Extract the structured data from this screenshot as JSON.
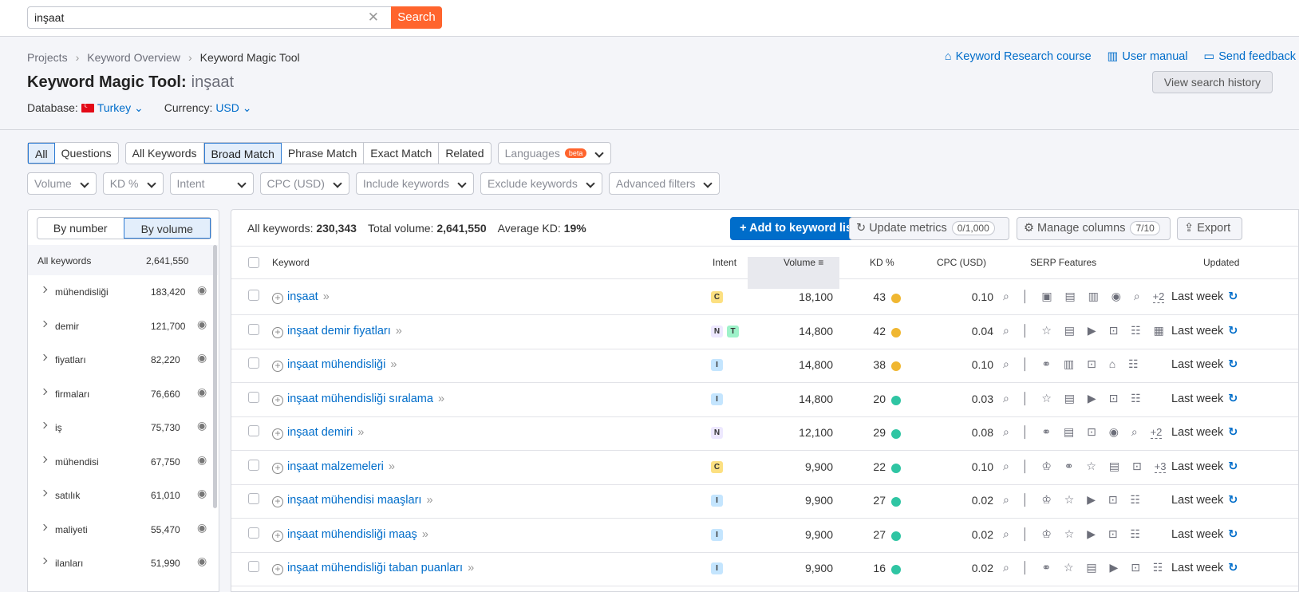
{
  "search": {
    "value": "inşaat",
    "clear": "✕",
    "button": "Search"
  },
  "breadcrumb": {
    "items": [
      "Projects",
      "Keyword Overview",
      "Keyword Magic Tool"
    ],
    "sep": "›"
  },
  "toplinks": {
    "course": "Keyword Research course",
    "manual": "User manual",
    "feedback": "Send feedback"
  },
  "title": {
    "main": "Keyword Magic Tool:",
    "query": "inşaat"
  },
  "history_button": "View search history",
  "database": {
    "label": "Database:",
    "value": "Turkey",
    "currency_label": "Currency:",
    "currency": "USD"
  },
  "tabs1": [
    "All",
    "Questions"
  ],
  "tabs2": [
    "All Keywords",
    "Broad Match",
    "Phrase Match",
    "Exact Match",
    "Related"
  ],
  "languages": {
    "label": "Languages",
    "badge": "beta"
  },
  "filters": [
    "Volume",
    "KD %",
    "Intent",
    "CPC (USD)",
    "Include keywords",
    "Exclude keywords",
    "Advanced filters"
  ],
  "sidebar": {
    "toggle": [
      "By number",
      "By volume"
    ],
    "header": {
      "label": "All keywords",
      "value": "2,641,550"
    },
    "items": [
      {
        "label": "mühendisliği",
        "value": "183,420"
      },
      {
        "label": "demir",
        "value": "121,700"
      },
      {
        "label": "fiyatları",
        "value": "82,220"
      },
      {
        "label": "firmaları",
        "value": "76,660"
      },
      {
        "label": "iş",
        "value": "75,730"
      },
      {
        "label": "mühendisi",
        "value": "67,750"
      },
      {
        "label": "satılık",
        "value": "61,010"
      },
      {
        "label": "maliyeti",
        "value": "55,470"
      },
      {
        "label": "ilanları",
        "value": "51,990"
      }
    ]
  },
  "stats": {
    "kw_label": "All keywords:",
    "kw_value": "230,343",
    "vol_label": "Total volume:",
    "vol_value": "2,641,550",
    "kd_label": "Average KD:",
    "kd_value": "19%"
  },
  "actions": {
    "add": "+  Add to keyword list",
    "update": "Update metrics",
    "update_count": "0/1,000",
    "manage": "Manage columns",
    "manage_count": "7/10",
    "export": "Export"
  },
  "columns": {
    "keyword": "Keyword",
    "intent": "Intent",
    "volume": "Volume",
    "kd": "KD %",
    "cpc": "CPC (USD)",
    "serp": "SERP Features",
    "updated": "Updated"
  },
  "intent_colors": {
    "C": "#fce081",
    "N": "#ede8ff",
    "T": "#9ef2c9",
    "I": "#c4e5fe"
  },
  "rows": [
    {
      "keyword": "inşaat",
      "intents": [
        "C"
      ],
      "volume": "18,100",
      "kd": "43",
      "kd_color": "#f0b731",
      "cpc": "0.10",
      "serp": "⌕ │ ▣ ▤ ▥ ◉ ⌕",
      "more": "+2",
      "updated": "Last week"
    },
    {
      "keyword": "inşaat demir fiyatları",
      "intents": [
        "N",
        "T"
      ],
      "volume": "14,800",
      "kd": "42",
      "kd_color": "#f0b731",
      "cpc": "0.04",
      "serp": "⌕ │ ☆ ▤ ▶ ⊡ ☷ ▦",
      "more": "",
      "updated": "Last week"
    },
    {
      "keyword": "inşaat mühendisliği",
      "intents": [
        "I"
      ],
      "volume": "14,800",
      "kd": "38",
      "kd_color": "#f0b731",
      "cpc": "0.10",
      "serp": "⌕ │ ⚭ ▥ ⊡ ⌂ ☷",
      "more": "",
      "updated": "Last week"
    },
    {
      "keyword": "inşaat mühendisliği sıralama",
      "intents": [
        "I"
      ],
      "volume": "14,800",
      "kd": "20",
      "kd_color": "#2fc5a3",
      "cpc": "0.03",
      "serp": "⌕ │ ☆ ▤ ▶ ⊡ ☷",
      "more": "",
      "updated": "Last week"
    },
    {
      "keyword": "inşaat demiri",
      "intents": [
        "N"
      ],
      "volume": "12,100",
      "kd": "29",
      "kd_color": "#2fc5a3",
      "cpc": "0.08",
      "serp": "⌕ │ ⚭ ▤ ⊡ ◉ ⌕",
      "more": "+2",
      "updated": "Last week"
    },
    {
      "keyword": "inşaat malzemeleri",
      "intents": [
        "C"
      ],
      "volume": "9,900",
      "kd": "22",
      "kd_color": "#2fc5a3",
      "cpc": "0.10",
      "serp": "⌕ │ ♔ ⚭ ☆ ▤ ⊡",
      "more": "+3",
      "updated": "Last week"
    },
    {
      "keyword": "inşaat mühendisi maaşları",
      "intents": [
        "I"
      ],
      "volume": "9,900",
      "kd": "27",
      "kd_color": "#2fc5a3",
      "cpc": "0.02",
      "serp": "⌕ │ ♔ ☆ ▶ ⊡ ☷",
      "more": "",
      "updated": "Last week"
    },
    {
      "keyword": "inşaat mühendisliği maaş",
      "intents": [
        "I"
      ],
      "volume": "9,900",
      "kd": "27",
      "kd_color": "#2fc5a3",
      "cpc": "0.02",
      "serp": "⌕ │ ♔ ☆ ▶ ⊡ ☷",
      "more": "",
      "updated": "Last week"
    },
    {
      "keyword": "inşaat mühendisliği taban puanları",
      "intents": [
        "I"
      ],
      "volume": "9,900",
      "kd": "16",
      "kd_color": "#2fc5a3",
      "cpc": "0.02",
      "serp": "⌕ │ ⚭ ☆ ▤ ▶ ⊡ ☷",
      "more": "",
      "updated": "Last week"
    }
  ]
}
